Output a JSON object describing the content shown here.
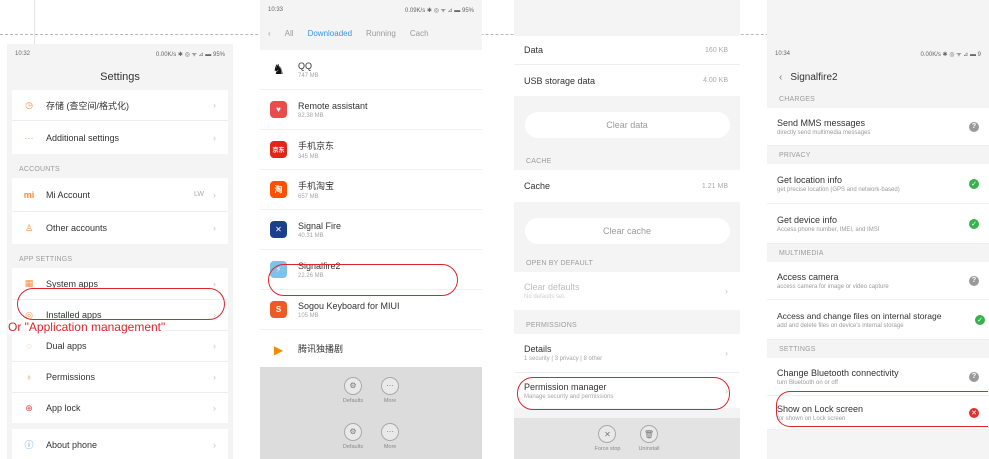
{
  "colors": {
    "accent_blue": "#3e94e8",
    "highlight_red": "#d9262b",
    "ok_green": "#37b24d"
  },
  "phone1": {
    "status_time": "10:32",
    "status_right": "0.00K/s ✱ ◎ ᯤ ⊿ ▬ 95%",
    "title": "Settings",
    "items": [
      {
        "label": "存储 (查空间/格式化)"
      },
      {
        "label": "Additional settings"
      }
    ],
    "section_accounts": "ACCOUNTS",
    "accounts": [
      {
        "label": "Mi Account",
        "value": "LW"
      },
      {
        "label": "Other accounts"
      }
    ],
    "section_app_settings": "APP SETTINGS",
    "apps": [
      {
        "label": "System apps"
      },
      {
        "label": "Installed apps"
      },
      {
        "label": "Dual apps"
      },
      {
        "label": "Permissions"
      },
      {
        "label": "App lock"
      }
    ],
    "about": "About phone",
    "caption": "Or \"Application management\""
  },
  "phone2": {
    "status_time": "10:33",
    "status_right": "0.09K/s ✱ ◎ ᯤ ⊿ ▬ 95%",
    "tabs": [
      "All",
      "Downloaded",
      "Running",
      "Cach"
    ],
    "apps": [
      {
        "name": "QQ",
        "size": "747 MB"
      },
      {
        "name": "Remote assistant",
        "size": "82.38 MB"
      },
      {
        "name": "手机京东",
        "size": "345 MB"
      },
      {
        "name": "手机淘宝",
        "size": "657 MB"
      },
      {
        "name": "Signal Fire",
        "size": "40.31 MB"
      },
      {
        "name": "Signalfire2",
        "size": "22.26 MB"
      },
      {
        "name": "Sogou Keyboard for MIUI",
        "size": "105 MB"
      },
      {
        "name": "腾讯独播剧",
        "size": ""
      }
    ],
    "bar_defaults": "Defaults",
    "bar_more": "More"
  },
  "phone3": {
    "top_label": "Data",
    "top_value": "160 KB",
    "usb_label": "USB storage data",
    "usb_value": "4.00 KB",
    "clear_data": "Clear data",
    "section_cache": "CACHE",
    "cache_label": "Cache",
    "cache_value": "1.21 MB",
    "clear_cache": "Clear cache",
    "section_open": "OPEN BY DEFAULT",
    "clear_defaults": "Clear defaults",
    "clear_defaults_sub": "No defaults set.",
    "section_permissions": "PERMISSIONS",
    "details": "Details",
    "details_sub": "1 security | 3 privacy | 8 other",
    "perm_manager": "Permission manager",
    "perm_manager_sub": "Manage security and permissions",
    "force_stop": "Force stop",
    "uninstall": "Uninstall"
  },
  "phone4": {
    "status_time": "10:34",
    "status_right": "0.00K/s ✱ ◎ ᯤ ⊿ ▬ 9",
    "title": "Signalfire2",
    "section_charges": "CHARGES",
    "mms": "Send MMS messages",
    "mms_sub": "directly send multimedia messages",
    "section_privacy": "PRIVACY",
    "location": "Get location info",
    "location_sub": "get precise location (GPS and network-based)",
    "device": "Get device info",
    "device_sub": "Access phone number, IMEI, and IMSI",
    "section_multimedia": "MULTIMEDIA",
    "camera": "Access camera",
    "camera_sub": "access camera for image or video capture",
    "files": "Access and change files on internal storage",
    "files_sub": "add and delete files on device's internal storage",
    "section_settings": "SETTINGS",
    "bluetooth": "Change Bluetooth connectivity",
    "bluetooth_sub": "turn Bluetooth on or off",
    "lock": "Show on Lock screen",
    "lock_sub": "for shown on Lock screen"
  }
}
